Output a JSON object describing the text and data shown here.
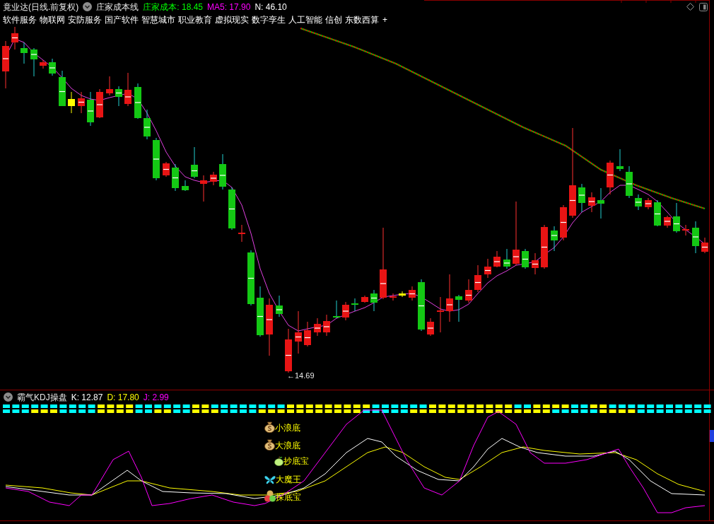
{
  "header": {
    "title": "竟业达(日线.前复权)",
    "indicator_name": "庄家成本线",
    "readings": [
      {
        "label": "庄家成本: 18.45",
        "color": "#00ff00"
      },
      {
        "label": "MA5: 17.90",
        "color": "#ff00ff"
      },
      {
        "label": "N: 46.10",
        "color": "#ffffff"
      }
    ]
  },
  "concept_tags": [
    "软件服务",
    "物联网",
    "安防服务",
    "国产软件",
    "智慧城市",
    "职业教育",
    "虚拟现实",
    "数字孪生",
    "人工智能",
    "信创",
    "东数西算"
  ],
  "add_tag": "+",
  "price_chart": {
    "low_label": "←14.69"
  },
  "kdj_panel": {
    "title": "霸气KDJ操盘",
    "readings": [
      {
        "label": "K: 12.87",
        "color": "#ffffff"
      },
      {
        "label": "D: 17.80",
        "color": "#ffff00"
      },
      {
        "label": "J: 2.99",
        "color": "#ff00ff"
      }
    ]
  },
  "signals": [
    {
      "kind": "money-bag",
      "label": "小浪底"
    },
    {
      "kind": "money-bag",
      "label": "大浪底"
    },
    {
      "kind": "apple",
      "label": "抄底宝"
    },
    {
      "kind": "butterfly",
      "label": "大魔王"
    },
    {
      "kind": "balls",
      "label": "探底宝"
    }
  ]
}
